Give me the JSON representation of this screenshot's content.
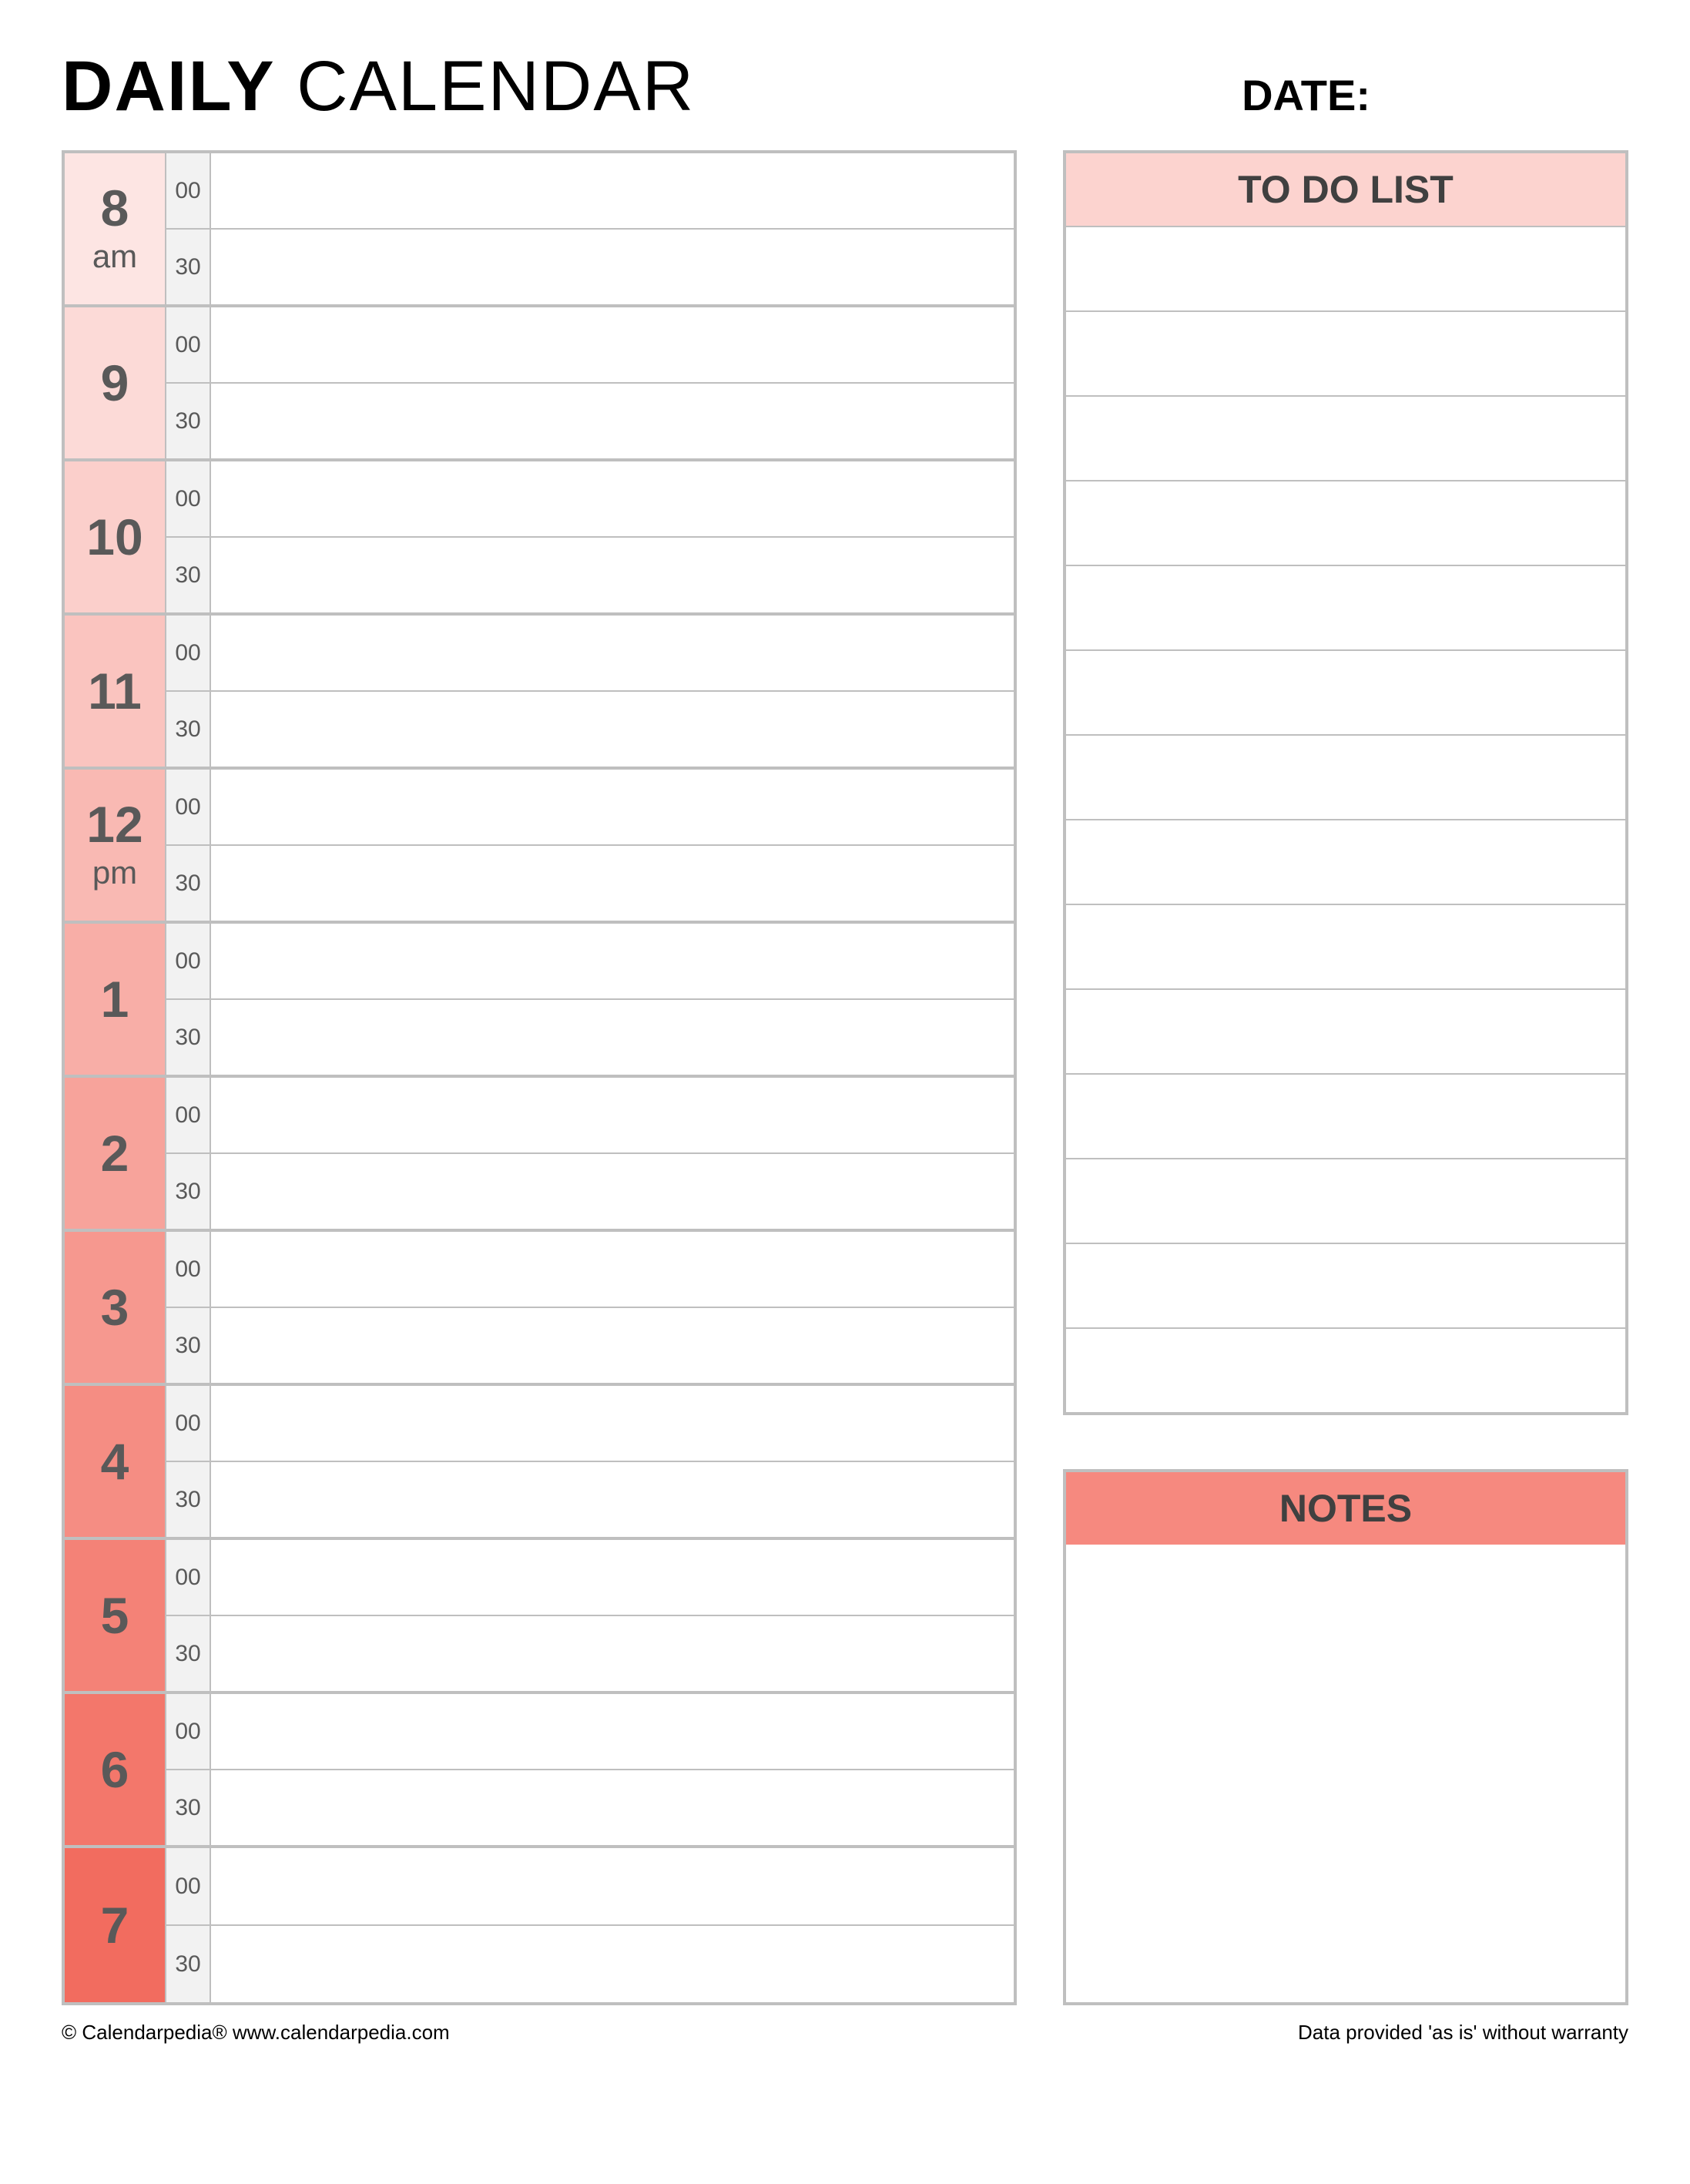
{
  "title_bold": "DAILY",
  "title_light": " CALENDAR",
  "date_label": "DATE:",
  "minutes": {
    "top": "00",
    "bottom": "30"
  },
  "hours": [
    {
      "num": "8",
      "ampm": "am",
      "color": "#fde5e3"
    },
    {
      "num": "9",
      "ampm": "",
      "color": "#fcdad7"
    },
    {
      "num": "10",
      "ampm": "",
      "color": "#fbcfcb"
    },
    {
      "num": "11",
      "ampm": "",
      "color": "#fac4bf"
    },
    {
      "num": "12",
      "ampm": "pm",
      "color": "#f9b9b3"
    },
    {
      "num": "1",
      "ampm": "",
      "color": "#f8aea7"
    },
    {
      "num": "2",
      "ampm": "",
      "color": "#f7a39b"
    },
    {
      "num": "3",
      "ampm": "",
      "color": "#f6988f"
    },
    {
      "num": "4",
      "ampm": "",
      "color": "#f58d83"
    },
    {
      "num": "5",
      "ampm": "",
      "color": "#f48277"
    },
    {
      "num": "6",
      "ampm": "",
      "color": "#f3776b"
    },
    {
      "num": "7",
      "ampm": "",
      "color": "#f26c5f"
    }
  ],
  "todo": {
    "header": "TO DO LIST",
    "header_bg": "#fcd3cf",
    "rows": 14
  },
  "notes": {
    "header": "NOTES",
    "header_bg": "#f6897f"
  },
  "footer": {
    "left": "© Calendarpedia®   www.calendarpedia.com",
    "right": "Data provided 'as is' without warranty"
  }
}
